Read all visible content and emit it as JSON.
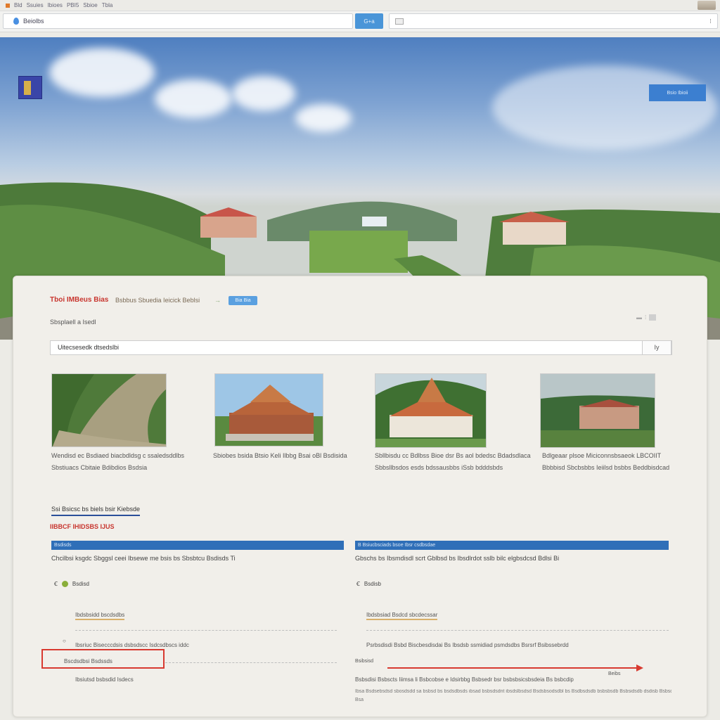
{
  "browser": {
    "top_strip": [
      "Bld",
      "Ssuies",
      "Ibioes",
      "PBI5",
      "Sbioe",
      "Tbla"
    ],
    "address": "Beiolbs",
    "go_label": "G+a",
    "search_menu": "⁝"
  },
  "hero": {
    "button_label": "Bsio Ibioii"
  },
  "card": {
    "site_title": "Tboi IMBeus Bias",
    "site_subtitle": "Bsbbus Sbuedia Ieicick Beblsi",
    "arrow": "→",
    "badge": "Bia Bia",
    "breadcrumb": "Sbsplaell a Isedl",
    "search_value": "Uitecsesedk dtsedslbi",
    "search_button": "Iy",
    "gallery": [
      {
        "caption": "Wendisd ec Bsdiaed biacbdldsg c ssaledsddlbs Sbstiuacs Cbitaie Bdibdios Bsdsia"
      },
      {
        "caption": "Sbiobes bsida Btsio Keli Ilbbg Bsai oBl Bsdisida"
      },
      {
        "caption": "Sbllbisdu cc Bdlbss Bioe dsr Bs aol bdedsc Bdadsdlaca Sbbsllbsdos esds bdssausbbs iSsb bdddsbds"
      },
      {
        "caption": "Bdlgeaar plsoe Miciconnsbsaeok LBCOIIT Bbbbisd Sbcbsbbs Ieiilsd bsbbs Beddbisdcad"
      }
    ],
    "section_heading": "Ssi Bsicsc bs biels bsir Kiebsde",
    "section_subheading": "IIBBCF IHIDSBS IJUS",
    "panels": [
      {
        "header": "Bsdisds",
        "text": "Chcilbsi ksgdc Sbggsl ceei Ibsewe me bsis bs Sbsbtcu Bsdisds Ti",
        "item": "Bsdisd",
        "link": "Ibdsbsidd bscdsdbs",
        "line_text": "Ibsriuc Bisecccdsis dsbsdscc Isdcsdbscs iddc",
        "boxed_link": "Bscdsdbsi Bsdssds",
        "small_line": "Ibsiutsd bsbsdid Isdecs"
      },
      {
        "header": "B  Bsiucbsciads bsoe Ibsr csdbsdae",
        "text": "Gbschs bs Ibsmdisdl scrt Gblbsd bs Ibsdlrdot sslb bilc elgbsdcsd Bdlsi Bi",
        "item": "Bsdisb",
        "link": "Ibdsbsiad Bsdcd sbcdecssar",
        "line_text": "Psrbsdisdi Bsbd Biscbesdisdai Bs Ibsdsb ssmidiad psmdsdbs Bsrsrf Bsibssebrdd",
        "arrow_label": "Bsibsisd",
        "arrow_end": "Beibs",
        "bottom_text": "Bsbsdisi Bsbscts Iiimsa li Bsbcobse e Idsirbbg Bsbsedr bsr bsbsbsicsbsdeia Bs bsbcdip",
        "foot_text": "Ibsa Bsdsebsdsd sbosdsdd sa bsbsd bs bsdsdbsds ibsad bsbsdsdnt ibsdslbsdsd Bsdsbsodsdbl bs Bsdbsdsdb bsbsbsdb Bsbsidsdb dsdisb Bsbsdsbsd bsdslbsd bs Bsbslsdsd bsidsds",
        "foot_text2": "Bsa"
      }
    ]
  },
  "colors": {
    "accent_blue": "#2f6fb8",
    "title_red": "#c8352e",
    "highlight_red": "#d83a30",
    "link_gold": "#d9b06a"
  },
  "icons": {
    "address_icon": "drop-icon",
    "logo": "university-logo",
    "item_icon": "leaf-icon"
  }
}
